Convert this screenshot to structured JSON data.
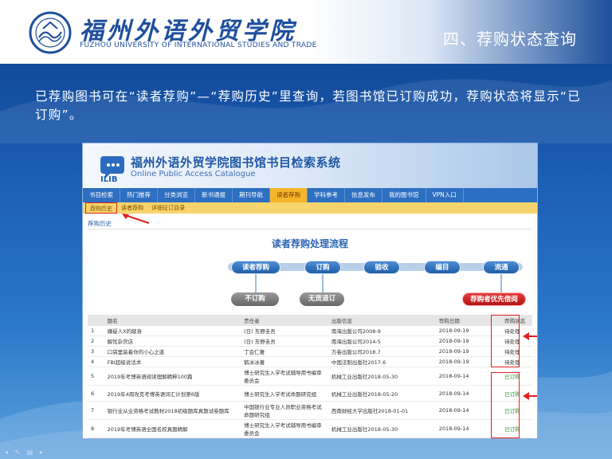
{
  "header": {
    "logo_name": "福州外语外贸学院",
    "logo_subtitle": "FUZHOU UNIVERSITY OF INTERNATIONAL STUDIES AND TRADE",
    "slide_title": "四、荐购状态查询"
  },
  "caption": "已荐购图书可在“读者荐购”—“荐购历史”里查询，若图书馆已订购成功，荐购状态将显示“已订购”。",
  "screenshot": {
    "system_title": "福州外语外贸学院图书馆书目检索系统",
    "system_subtitle": "Online Public Access Catalogue",
    "logo_text": "ILIB",
    "nav": [
      "书目检索",
      "热门推荐",
      "分类浏览",
      "新书通报",
      "期刊导航",
      "读者荐购",
      "学科参考",
      "信息发布",
      "我的图书馆",
      "VPN入口"
    ],
    "nav_active_index": 5,
    "subnav": [
      "荐购历史",
      "读者荐购",
      "详细征订目录"
    ],
    "breadcrumb": "荐购历史",
    "flow_title": "读者荐购处理流程",
    "flow_steps": [
      "读者荐购",
      "订购",
      "验收",
      "编目",
      "流通"
    ],
    "flow_outcomes": [
      "不订购",
      "无货退订",
      "荐购者优先借阅"
    ],
    "table": {
      "headers": [
        "",
        "题名",
        "责任者",
        "出版信息",
        "荐购日期",
        "荐购状态"
      ],
      "rows": [
        {
          "no": "1",
          "title": "嫌疑人X的献身",
          "author": "(日) 东野圭吾",
          "pub": "南海出版公司2008-9",
          "date": "2018-09-19",
          "status": "待处理",
          "ok": false
        },
        {
          "no": "2",
          "title": "解忧杂货店",
          "author": "(日) 东野圭吾",
          "pub": "南海出版公司2014-5",
          "date": "2018-09-19",
          "status": "待处理",
          "ok": false
        },
        {
          "no": "3",
          "title": "口袋里装着你的小心之道",
          "author": "丁会仁著",
          "pub": "万卷出版公司2018.7",
          "date": "2018-09-19",
          "status": "待处理",
          "ok": false
        },
        {
          "no": "4",
          "title": "FBI超级说话术",
          "author": "鹤冰冰著",
          "pub": "中国法制出版社2017.6",
          "date": "2018-09-19",
          "status": "待处理",
          "ok": false
        },
        {
          "no": "5",
          "title": "2019年考博英语阅读理解精粹100篇",
          "author": "博士研究生入学考试辅导用书编审委员会",
          "pub": "机械工业出版社2018-05-30",
          "date": "2018-09-14",
          "status": "已订购",
          "ok": true
        },
        {
          "no": "6",
          "title": "2019年4周攻克考博英语词汇计划第6版",
          "author": "博士研究生入学考试命题研究组",
          "pub": "机械工业出版社2018-05-20",
          "date": "2018-09-14",
          "status": "已订购",
          "ok": true
        },
        {
          "no": "7",
          "title": "银行业从业资格考试教材2018初级题库真题试卷题库",
          "author": "中国银行业专业人员职业资格考试命题研究组",
          "pub": "西南财经大学出版社2018-01-01",
          "date": "2018-09-14",
          "status": "已订购",
          "ok": true
        },
        {
          "no": "8",
          "title": "2019年考博英语全国名校真题精解",
          "author": "博士研究生入学考试辅导用书编审委员会",
          "pub": "机械工业出版社2018-05-30",
          "date": "2018-09-14",
          "status": "已订购",
          "ok": true
        }
      ]
    }
  },
  "colors": {
    "brand_blue": "#1f4f9d",
    "nav_blue": "#2d6fc1",
    "active_tab": "#f6b52a",
    "highlight_red": "#e02020",
    "ordered_green": "#2e8b2e"
  }
}
